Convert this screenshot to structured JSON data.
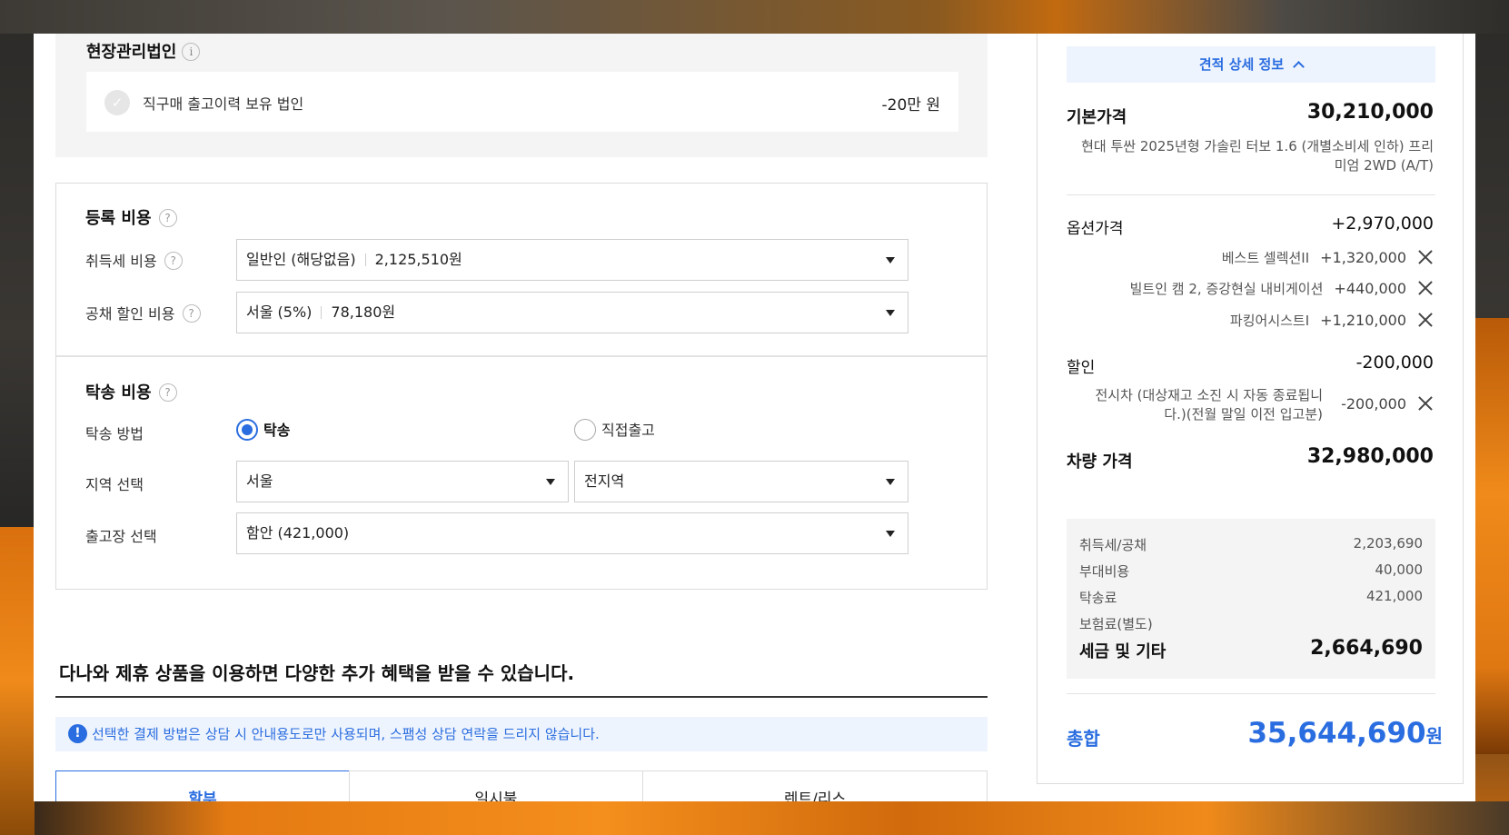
{
  "corp": {
    "title": "현장관리법인",
    "item_label": "직구매 출고이력 보유 법인",
    "item_amount": "-20만 원"
  },
  "registration": {
    "title": "등록 비용",
    "acq_tax_label": "취득세 비용",
    "acq_tax_select": "일반인 (해당없음)",
    "acq_tax_amount": "2,125,510원",
    "bond_label": "공채 할인 비용",
    "bond_select": "서울 (5%)",
    "bond_amount": "78,180원"
  },
  "delivery": {
    "title": "탁송 비용",
    "method_label": "탁송 방법",
    "method_option_1": "탁송",
    "method_option_2": "직접출고",
    "region_label": "지역 선택",
    "region_select_1": "서울",
    "region_select_2": "전지역",
    "depot_label": "출고장 선택",
    "depot_select": "함안 (421,000)"
  },
  "promo": {
    "title": "다나와 제휴 상품을 이용하면 다양한 추가 혜택을 받을 수 있습니다.",
    "notice": "선택한 결제 방법은 상담 시 안내용도로만 사용되며, 스팸성 상담 연락을 드리지 않습니다.",
    "notice_icon": "!",
    "tabs": [
      "할부",
      "일시불",
      "렌트/리스"
    ]
  },
  "summary": {
    "detail_button": "견적 상세 정보",
    "base_label": "기본가격",
    "base_value": "30,210,000",
    "base_desc": "현대 투싼 2025년형 가솔린 터보 1.6 (개별소비세 인하) 프리미엄 2WD (A/T)",
    "option_label": "옵션가격",
    "option_value": "+2,970,000",
    "options": [
      {
        "name": "베스트 셀렉션II",
        "value": "+1,320,000"
      },
      {
        "name": "빌트인 캠 2, 증강현실 내비게이션",
        "value": "+440,000"
      },
      {
        "name": "파킹어시스트I",
        "value": "+1,210,000"
      }
    ],
    "discount_label": "할인",
    "discount_value": "-200,000",
    "discount_item_name": "전시차 (대상재고 소진 시 자동 종료됩니다.)(전월 말일 이전 입고분)",
    "discount_item_value": "-200,000",
    "vehicle_label": "차량 가격",
    "vehicle_value": "32,980,000",
    "tax_rows": [
      {
        "name": "취득세/공채",
        "value": "2,203,690"
      },
      {
        "name": "부대비용",
        "value": "40,000"
      },
      {
        "name": "탁송료",
        "value": "421,000"
      },
      {
        "name": "보험료(별도)",
        "value": ""
      }
    ],
    "tax_total_label": "세금 및 기타",
    "tax_total_value": "2,664,690",
    "total_label": "총합",
    "total_value": "35,644,690",
    "total_unit": "원"
  },
  "colors": {
    "accent": "#2a6de0",
    "panel_gray": "#f4f4f4",
    "notice_bg": "#eef4fd"
  }
}
